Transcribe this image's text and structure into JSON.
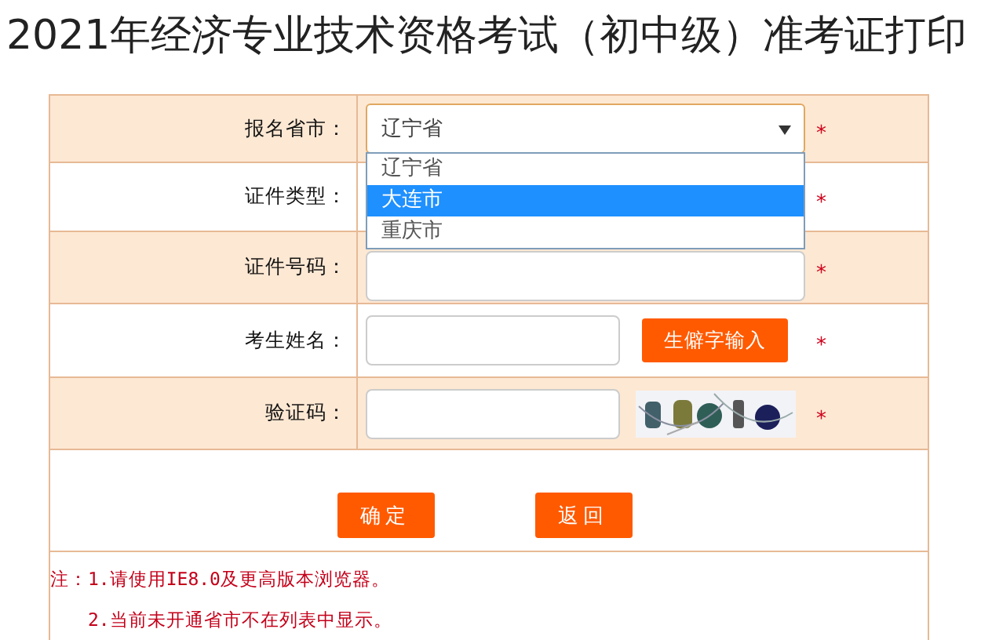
{
  "title": "2021年经济专业技术资格考试（初中级）准考证打印",
  "rows": [
    {
      "kind": "select",
      "label": "报名省市：",
      "value": "辽宁省",
      "mark": "*",
      "open": true,
      "options": [
        {
          "label": "辽宁省",
          "highlighted": false
        },
        {
          "label": "大连市",
          "highlighted": true
        },
        {
          "label": "重庆市",
          "highlighted": false
        }
      ]
    },
    {
      "kind": "covered",
      "label": "证件类型：",
      "mark": "*"
    },
    {
      "kind": "input",
      "label": "证件号码：",
      "mark": "*"
    },
    {
      "kind": "name",
      "label": "考生姓名：",
      "mark": "*",
      "button": "生僻字输入"
    },
    {
      "kind": "captcha",
      "label": "验证码：",
      "mark": "*"
    }
  ],
  "buttons": [
    "确定",
    "返回"
  ],
  "notes": [
    "注：1.请使用IE8.0及更高版本浏览器。",
    "2.当前未开通省市不在列表中显示。"
  ]
}
